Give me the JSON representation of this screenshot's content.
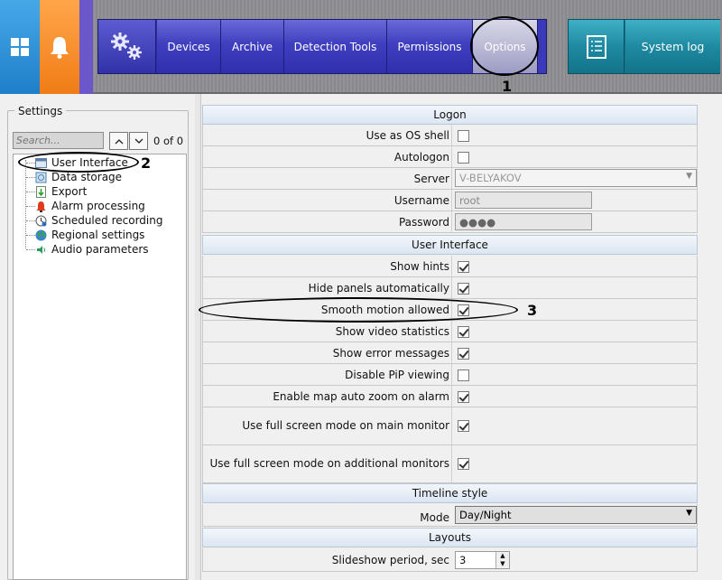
{
  "topbar": {
    "nav": [
      {
        "id": "devices",
        "label": "Devices"
      },
      {
        "id": "archive",
        "label": "Archive"
      },
      {
        "id": "detection",
        "label": "Detection Tools"
      },
      {
        "id": "permissions",
        "label": "Permissions"
      },
      {
        "id": "options",
        "label": "Options",
        "active": true
      }
    ],
    "system_log_label": "System log"
  },
  "sidebar": {
    "legend": "Settings",
    "search_placeholder": "Search...",
    "search_count": "0 of 0",
    "items": [
      {
        "label": "User Interface",
        "icon": "user-interface-icon",
        "selected": true
      },
      {
        "label": "Data storage",
        "icon": "data-storage-icon"
      },
      {
        "label": "Export",
        "icon": "export-icon"
      },
      {
        "label": "Alarm processing",
        "icon": "alarm-icon"
      },
      {
        "label": "Scheduled recording",
        "icon": "scheduled-recording-icon"
      },
      {
        "label": "Regional settings",
        "icon": "globe-icon"
      },
      {
        "label": "Audio parameters",
        "icon": "audio-icon"
      }
    ]
  },
  "logon": {
    "header": "Logon",
    "use_as_os_shell": {
      "label": "Use as OS shell",
      "checked": false
    },
    "autologon": {
      "label": "Autologon",
      "checked": false
    },
    "server": {
      "label": "Server",
      "value": "V-BELYAKOV"
    },
    "username": {
      "label": "Username",
      "value": "root"
    },
    "password": {
      "label": "Password",
      "value": "●●●●"
    }
  },
  "ui": {
    "header": "User Interface",
    "rows": [
      {
        "label": "Show hints",
        "checked": true
      },
      {
        "label": "Hide panels automatically",
        "checked": true
      },
      {
        "label": "Smooth motion allowed",
        "checked": true
      },
      {
        "label": "Show video statistics",
        "checked": true
      },
      {
        "label": "Show error messages",
        "checked": true
      },
      {
        "label": "Disable PiP viewing",
        "checked": false
      },
      {
        "label": "Enable map auto zoom on alarm",
        "checked": true
      },
      {
        "label": "Use full screen mode on main monitor",
        "checked": true
      },
      {
        "label": "Use full screen mode on additional monitors",
        "checked": true
      }
    ]
  },
  "timeline": {
    "header": "Timeline style",
    "mode_label": "Mode",
    "mode_value": "Day/Night"
  },
  "layouts": {
    "header": "Layouts",
    "slideshow_label": "Slideshow period, sec",
    "slideshow_value": "3"
  },
  "annotations": {
    "one": "1",
    "two": "2",
    "three": "3"
  },
  "colors": {
    "nav_blue": "#3f3fbf",
    "syslog_teal": "#1e8aa2",
    "win_tile": "#2d8fd8",
    "bell_tile": "#f58a24"
  }
}
